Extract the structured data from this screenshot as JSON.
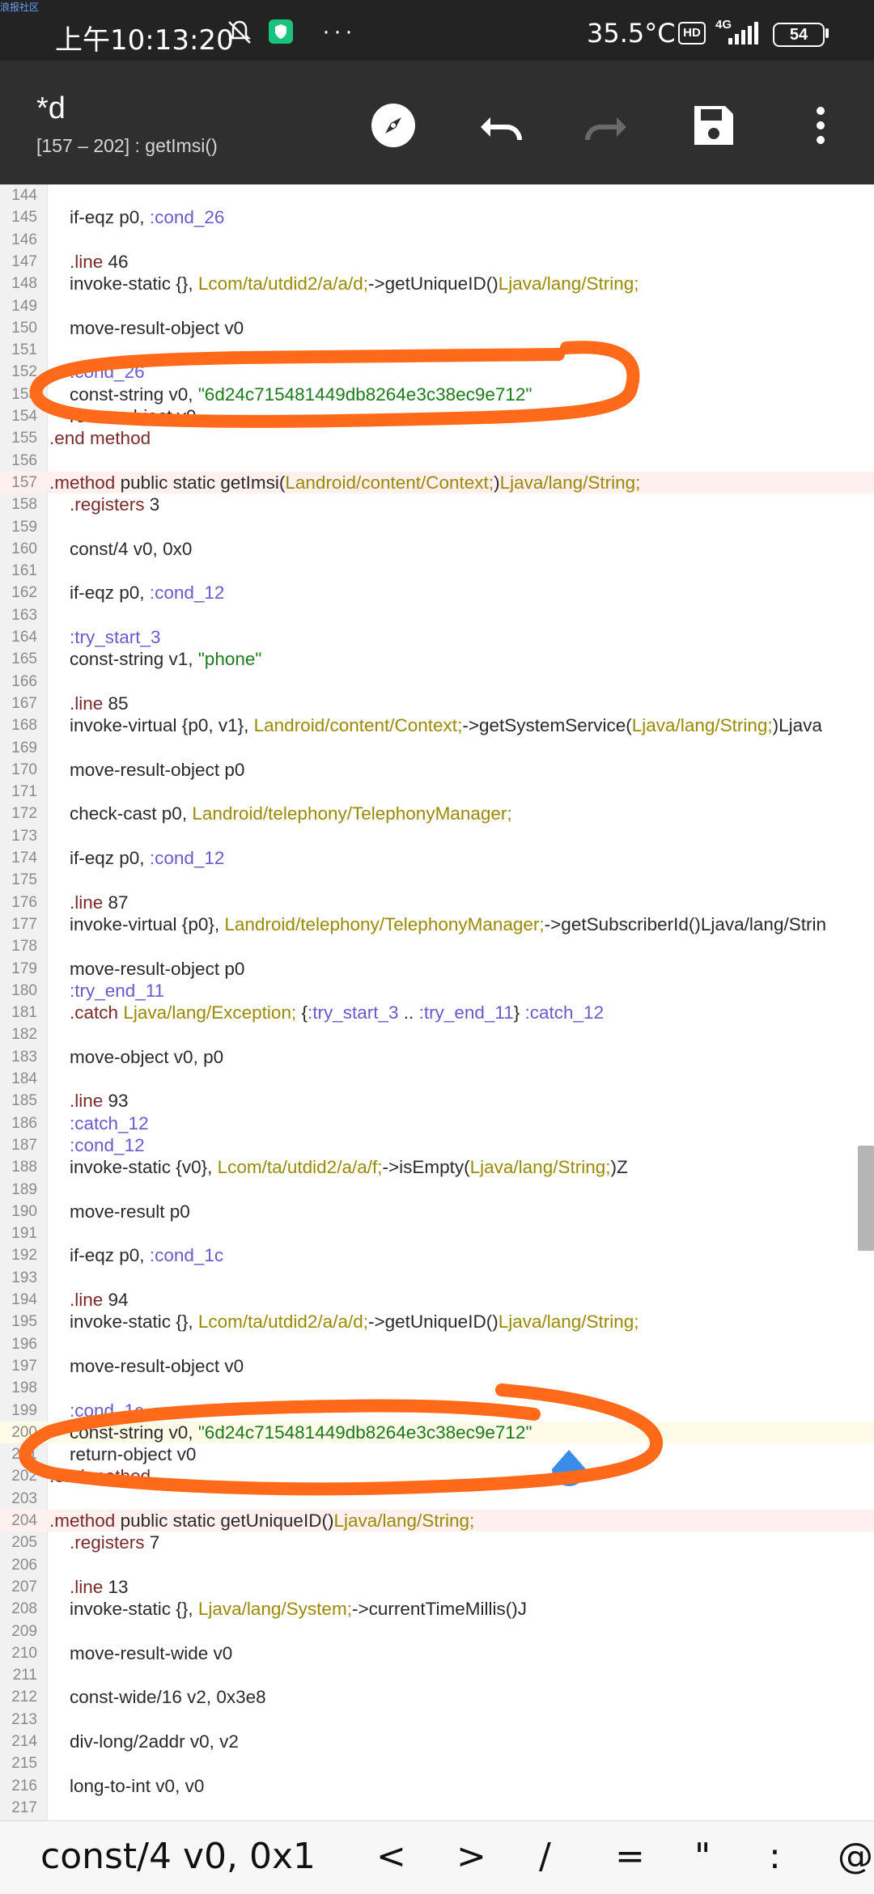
{
  "watermark": "浪报社区",
  "status_bar": {
    "time": "上午10:13:20",
    "temperature": "35.5°C",
    "hd": "HD",
    "network": "4G",
    "battery": "54"
  },
  "toolbar": {
    "title": "*d",
    "subtitle": "[157 – 202] : getImsi()",
    "icons": [
      "compass-icon",
      "undo-icon",
      "redo-icon",
      "save-icon",
      "more-vert-icon"
    ]
  },
  "editor": {
    "lines": [
      {
        "n": "144",
        "t": ""
      },
      {
        "n": "145",
        "t": "    if-eqz p0, :cond_26"
      },
      {
        "n": "146",
        "t": ""
      },
      {
        "n": "147",
        "t": "    .line 46"
      },
      {
        "n": "148",
        "t": "    invoke-static {}, Lcom/ta/utdid2/a/a/d;->getUniqueID()Ljava/lang/String;"
      },
      {
        "n": "149",
        "t": ""
      },
      {
        "n": "150",
        "t": "    move-result-object v0"
      },
      {
        "n": "151",
        "t": ""
      },
      {
        "n": "152",
        "t": "    :cond_26"
      },
      {
        "n": "153",
        "t": "    const-string v0, \"6d24c715481449db8264e3c38ec9e712\""
      },
      {
        "n": "154",
        "t": "    return-object v0"
      },
      {
        "n": "155",
        "t": ".end method"
      },
      {
        "n": "156",
        "t": ""
      },
      {
        "n": "157",
        "t": ".method public static getImsi(Landroid/content/Context;)Ljava/lang/String;",
        "hl": "method"
      },
      {
        "n": "158",
        "t": "    .registers 3"
      },
      {
        "n": "159",
        "t": ""
      },
      {
        "n": "160",
        "t": "    const/4 v0, 0x0"
      },
      {
        "n": "161",
        "t": ""
      },
      {
        "n": "162",
        "t": "    if-eqz p0, :cond_12"
      },
      {
        "n": "163",
        "t": ""
      },
      {
        "n": "164",
        "t": "    :try_start_3"
      },
      {
        "n": "165",
        "t": "    const-string v1, \"phone\""
      },
      {
        "n": "166",
        "t": ""
      },
      {
        "n": "167",
        "t": "    .line 85"
      },
      {
        "n": "168",
        "t": "    invoke-virtual {p0, v1}, Landroid/content/Context;->getSystemService(Ljava/lang/String;)Ljava"
      },
      {
        "n": "169",
        "t": ""
      },
      {
        "n": "170",
        "t": "    move-result-object p0"
      },
      {
        "n": "171",
        "t": ""
      },
      {
        "n": "172",
        "t": "    check-cast p0, Landroid/telephony/TelephonyManager;"
      },
      {
        "n": "173",
        "t": ""
      },
      {
        "n": "174",
        "t": "    if-eqz p0, :cond_12"
      },
      {
        "n": "175",
        "t": ""
      },
      {
        "n": "176",
        "t": "    .line 87"
      },
      {
        "n": "177",
        "t": "    invoke-virtual {p0}, Landroid/telephony/TelephonyManager;->getSubscriberId()Ljava/lang/Strin"
      },
      {
        "n": "178",
        "t": ""
      },
      {
        "n": "179",
        "t": "    move-result-object p0"
      },
      {
        "n": "180",
        "t": "    :try_end_11"
      },
      {
        "n": "181",
        "t": "    .catch Ljava/lang/Exception; {:try_start_3 .. :try_end_11} :catch_12"
      },
      {
        "n": "182",
        "t": ""
      },
      {
        "n": "183",
        "t": "    move-object v0, p0"
      },
      {
        "n": "184",
        "t": ""
      },
      {
        "n": "185",
        "t": "    .line 93"
      },
      {
        "n": "186",
        "t": "    :catch_12"
      },
      {
        "n": "187",
        "t": "    :cond_12"
      },
      {
        "n": "188",
        "t": "    invoke-static {v0}, Lcom/ta/utdid2/a/a/f;->isEmpty(Ljava/lang/String;)Z"
      },
      {
        "n": "189",
        "t": ""
      },
      {
        "n": "190",
        "t": "    move-result p0"
      },
      {
        "n": "191",
        "t": ""
      },
      {
        "n": "192",
        "t": "    if-eqz p0, :cond_1c"
      },
      {
        "n": "193",
        "t": ""
      },
      {
        "n": "194",
        "t": "    .line 94"
      },
      {
        "n": "195",
        "t": "    invoke-static {}, Lcom/ta/utdid2/a/a/d;->getUniqueID()Ljava/lang/String;"
      },
      {
        "n": "196",
        "t": ""
      },
      {
        "n": "197",
        "t": "    move-result-object v0"
      },
      {
        "n": "198",
        "t": ""
      },
      {
        "n": "199",
        "t": "    :cond_1c"
      },
      {
        "n": "200",
        "t": "    const-string v0, \"6d24c715481449db8264e3c38ec9e712\"",
        "hl": "current"
      },
      {
        "n": "201",
        "t": "    return-object v0"
      },
      {
        "n": "202",
        "t": ".end method"
      },
      {
        "n": "203",
        "t": ""
      },
      {
        "n": "204",
        "t": ".method public static getUniqueID()Ljava/lang/String;",
        "hl": "method"
      },
      {
        "n": "205",
        "t": "    .registers 7"
      },
      {
        "n": "206",
        "t": ""
      },
      {
        "n": "207",
        "t": "    .line 13"
      },
      {
        "n": "208",
        "t": "    invoke-static {}, Ljava/lang/System;->currentTimeMillis()J"
      },
      {
        "n": "209",
        "t": ""
      },
      {
        "n": "210",
        "t": "    move-result-wide v0"
      },
      {
        "n": "211",
        "t": ""
      },
      {
        "n": "212",
        "t": "    const-wide/16 v2, 0x3e8"
      },
      {
        "n": "213",
        "t": ""
      },
      {
        "n": "214",
        "t": "    div-long/2addr v0, v2"
      },
      {
        "n": "215",
        "t": ""
      },
      {
        "n": "216",
        "t": "    long-to-int v0, v0"
      },
      {
        "n": "217",
        "t": ""
      }
    ]
  },
  "symbol_bar": {
    "items": [
      "const/4 v0, 0x1",
      "<",
      ">",
      "/",
      "=",
      "\"",
      ":",
      "@"
    ]
  },
  "colors": {
    "annotation": "#ff6a1a",
    "method_highlight": "#fff0f0"
  }
}
